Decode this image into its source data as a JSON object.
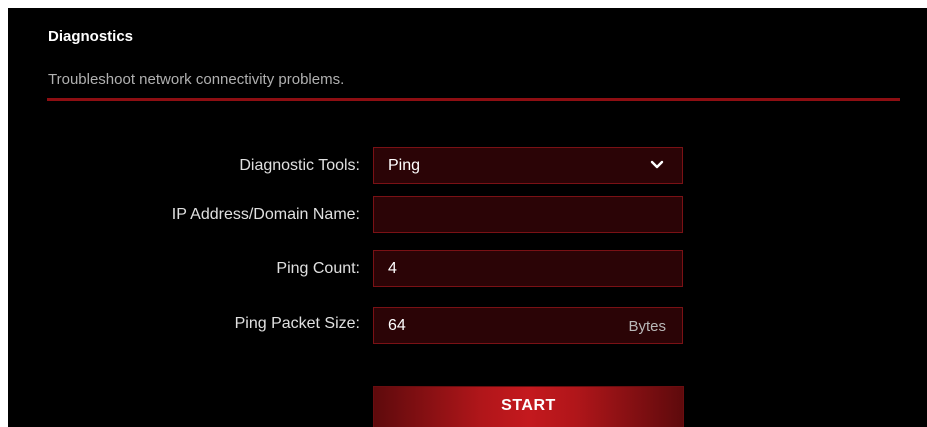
{
  "header": {
    "title": "Diagnostics",
    "subtitle": "Troubleshoot network connectivity problems."
  },
  "form": {
    "diagnostic_tools": {
      "label": "Diagnostic Tools:",
      "value": "Ping",
      "icon": "chevron-down-icon"
    },
    "ip_address": {
      "label": "IP Address/Domain Name:",
      "value": ""
    },
    "ping_count": {
      "label": "Ping Count:",
      "value": "4"
    },
    "ping_packet_size": {
      "label": "Ping Packet Size:",
      "value": "64",
      "unit": "Bytes"
    }
  },
  "actions": {
    "start_label": "START"
  },
  "colors": {
    "background": "#000000",
    "accent": "#c4191e",
    "divider": "#8d0e12",
    "field_bg": "#2b0406",
    "field_border": "#7a1115"
  }
}
